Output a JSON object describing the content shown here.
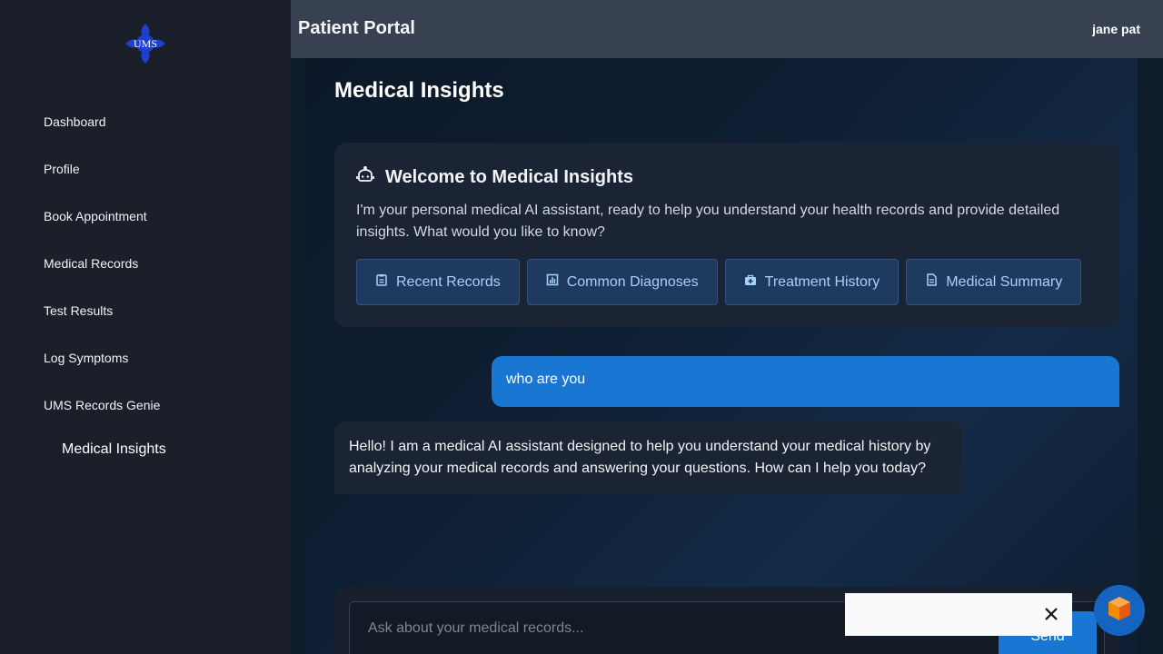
{
  "logo": {
    "text": "UMS",
    "color": "#1f3fd0"
  },
  "sidebar": {
    "items": [
      {
        "label": "Dashboard"
      },
      {
        "label": "Profile"
      },
      {
        "label": "Book Appointment"
      },
      {
        "label": "Medical Records"
      },
      {
        "label": "Test Results"
      },
      {
        "label": "Log Symptoms"
      },
      {
        "label": "UMS Records Genie"
      },
      {
        "label": "Medical Insights",
        "active": true
      }
    ]
  },
  "header": {
    "title": "Patient Portal",
    "user": "jane pat"
  },
  "main": {
    "title": "Medical Insights",
    "welcome": {
      "icon": "robot-icon",
      "title": "Welcome to Medical Insights",
      "text": "I'm your personal medical AI assistant, ready to help you understand your health records and provide detailed insights. What would you like to know?"
    },
    "quick_actions": [
      {
        "label": "Recent Records",
        "icon": "clipboard-icon"
      },
      {
        "label": "Common Diagnoses",
        "icon": "bar-chart-icon"
      },
      {
        "label": "Treatment History",
        "icon": "medical-bag-icon"
      },
      {
        "label": "Medical Summary",
        "icon": "document-icon"
      }
    ],
    "messages": [
      {
        "role": "user",
        "text": "who are you"
      },
      {
        "role": "assistant",
        "text": "Hello! I am a medical AI assistant designed to help you understand your medical history by analyzing your medical records and answering your questions. How can I help you today?"
      }
    ],
    "input": {
      "placeholder": "Ask about your medical records...",
      "value": "",
      "send_label": "Send"
    }
  },
  "colors": {
    "accent": "#1976d2",
    "sidebar_bg": "#1a1f29",
    "header_bg": "#374151",
    "chip_bg": "#1e3a5f",
    "fab_bg": "#1565c0"
  }
}
